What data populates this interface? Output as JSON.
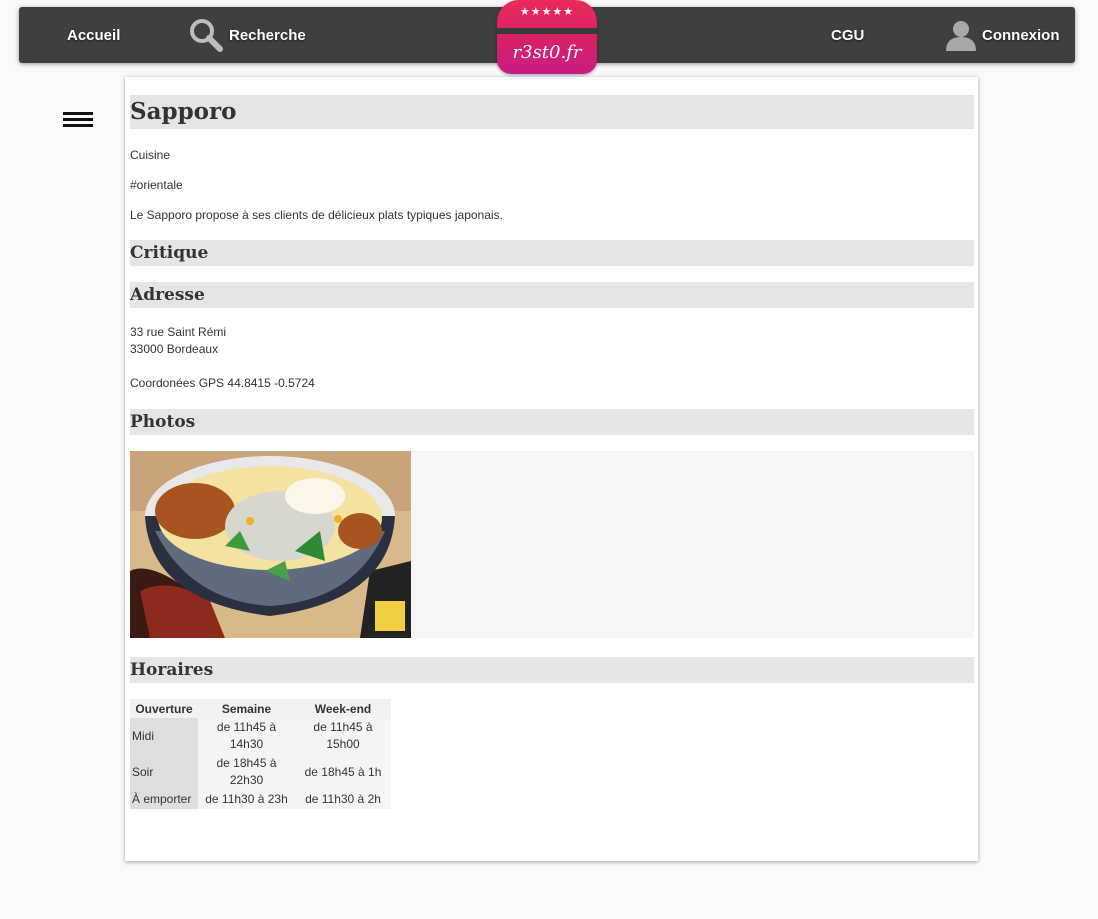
{
  "nav": {
    "home": "Accueil",
    "search": "Recherche",
    "cgu": "CGU",
    "login": "Connexion",
    "search_icon": "search-icon",
    "user_icon": "user-icon"
  },
  "logo": {
    "stars": "★★★★★",
    "text": "r3st0.fr",
    "colors": [
      "#ea2b57",
      "#c91c86"
    ]
  },
  "menu_icon": "hamburger-icon",
  "restaurant": {
    "name": "Sapporo",
    "cuisine_label": "Cuisine",
    "tag": "#orientale",
    "description": "Le Sapporo propose à ses clients de délicieux plats typiques japonais."
  },
  "sections": {
    "critique": "Critique",
    "adresse": "Adresse",
    "photos": "Photos",
    "horaires": "Horaires"
  },
  "address": {
    "line1": "33 rue Saint Rémi",
    "line2": "33000 Bordeaux",
    "gps": "Coordonées GPS 44.8415 -0.5724"
  },
  "hours": {
    "headers": [
      "Ouverture",
      "Semaine",
      "Week-end"
    ],
    "rows": [
      {
        "label": "Midi",
        "week": "de 11h45 à 14h30",
        "weekend": "de 11h45 à 15h00"
      },
      {
        "label": "Soir",
        "week": "de 18h45 à 22h30",
        "weekend": "de 18h45 à 1h"
      },
      {
        "label": "À emporter",
        "week": "de 11h30 à 23h",
        "weekend": "de 11h30 à 2h"
      }
    ]
  }
}
